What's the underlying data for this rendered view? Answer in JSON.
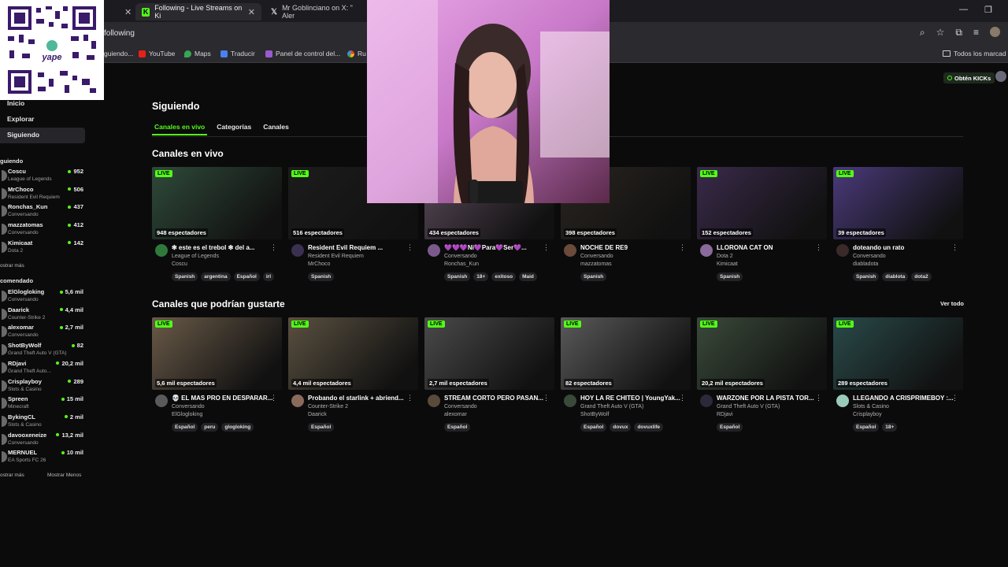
{
  "browser": {
    "tabs": [
      {
        "title": "Following - Live Streams on Ki",
        "active": true
      },
      {
        "title": "Mr Goblinciano on X: \" Aler",
        "active": false
      }
    ],
    "url": "following",
    "bookmarks": [
      "guiendo...",
      "YouTube",
      "Maps",
      "Traducir",
      "Panel de control del...",
      "Ru"
    ],
    "bookmarks_folder": "Todos los marcad"
  },
  "header": {
    "get_kicks": "Obtén KICKs"
  },
  "sidebar": {
    "nav": [
      "Inicio",
      "Explorar",
      "Siguiendo"
    ],
    "following_title": "guiendo",
    "following": [
      {
        "name": "Coscu",
        "game": "League of Legends",
        "viewers": "952"
      },
      {
        "name": "MrChoco",
        "game": "Resident Evil Requiem",
        "viewers": "506"
      },
      {
        "name": "Ronchas_Kun",
        "game": "Conversando",
        "viewers": "437"
      },
      {
        "name": "mazzatomas",
        "game": "Conversando",
        "viewers": "412"
      },
      {
        "name": "Kimicaat",
        "game": "Dota 2",
        "viewers": "142"
      }
    ],
    "show_more": "ostrar más",
    "recommended_title": "comendado",
    "recommended": [
      {
        "name": "ElGlogloking",
        "game": "Conversando",
        "viewers": "5,6 mil"
      },
      {
        "name": "Daarick",
        "game": "Counter-Strike 2",
        "viewers": "4,4 mil"
      },
      {
        "name": "alexomar",
        "game": "Conversando",
        "viewers": "2,7 mil"
      },
      {
        "name": "ShotByWolf",
        "game": "Grand Theft Auto V (GTA)",
        "viewers": "82"
      },
      {
        "name": "RDjavi",
        "game": "Grand Theft Auto...",
        "viewers": "20,2 mil"
      },
      {
        "name": "Crisplayboy",
        "game": "Slots & Casino",
        "viewers": "289"
      },
      {
        "name": "Spreen",
        "game": "Minecraft",
        "viewers": "15 mil"
      },
      {
        "name": "BykingCL",
        "game": "Slots & Casino",
        "viewers": "2 mil"
      },
      {
        "name": "davooxeneize",
        "game": "Conversando",
        "viewers": "13,2 mil"
      },
      {
        "name": "MERNUEL",
        "game": "EA Sports FC 26",
        "viewers": "10 mil"
      }
    ],
    "show_more2": "ostrar más",
    "show_less": "Mostrar Menos"
  },
  "main": {
    "title": "Siguiendo",
    "tabs": [
      "Canales en vivo",
      "Categorías",
      "Canales"
    ],
    "live_title": "Canales en vivo",
    "recommended_title": "Canales que podrían gustarte",
    "see_all": "Ver todo",
    "live_label": "LIVE",
    "live_cards": [
      {
        "title": "❇ este es el trebol ❇ del a...",
        "category": "League of Legends",
        "channel": "Coscu",
        "viewers": "948 espectadores",
        "tags": [
          "Spanish",
          "argentina",
          "Español",
          "irl"
        ],
        "color": "#2f4a3a",
        "av": "#2f7a3a"
      },
      {
        "title": "Resident Evil Requiem ...",
        "category": "Resident Evil Requiem",
        "channel": "MrChoco",
        "viewers": "516 espectadores",
        "tags": [
          "Spanish"
        ],
        "color": "#1c1c1c",
        "av": "#3a3050"
      },
      {
        "title": "💜💜💜Ni💜Para💜Ser💜...",
        "category": "Conversando",
        "channel": "Ronchas_Kun",
        "viewers": "434 espectadores",
        "tags": [
          "Spanish",
          "18+",
          "exitoso",
          "Maid"
        ],
        "color": "#5a4a5a",
        "av": "#7a5a8a"
      },
      {
        "title": "NOCHE DE RE9",
        "category": "Conversando",
        "channel": "mazzatomas",
        "viewers": "398 espectadores",
        "tags": [
          "Spanish"
        ],
        "color": "#2a2420",
        "av": "#6a4a3a"
      },
      {
        "title": "LLORONA CAT ON",
        "category": "Dota 2",
        "channel": "Kimicaat",
        "viewers": "152 espectadores",
        "tags": [
          "Spanish"
        ],
        "color": "#3a2a4a",
        "av": "#8a6a9a"
      },
      {
        "title": "doteando un rato",
        "category": "Conversando",
        "channel": "diabladota",
        "viewers": "39 espectadores",
        "tags": [
          "Spanish",
          "diablota",
          "dota2"
        ],
        "color": "#4a3a7a",
        "av": "#3a2a2a"
      }
    ],
    "rec_cards": [
      {
        "title": "💀 EL MAS PRO EN DESPARAR...",
        "category": "Conversando",
        "channel": "ElGlogloking",
        "viewers": "5,6 mil espectadores",
        "tags": [
          "Español",
          "peru",
          "glogloking"
        ],
        "color": "#6a5a48",
        "av": "#5a5a5a"
      },
      {
        "title": "Probando el starlink + abriend...",
        "category": "Counter-Strike 2",
        "channel": "Daarick",
        "viewers": "4,4 mil espectadores",
        "tags": [
          "Español"
        ],
        "color": "#5a5040",
        "av": "#8a6a5a"
      },
      {
        "title": "STREAM CORTO PERO PASAN...",
        "category": "Conversando",
        "channel": "alexomar",
        "viewers": "2,7 mil espectadores",
        "tags": [
          "Español"
        ],
        "color": "#4a4a4a",
        "av": "#5a4a3a"
      },
      {
        "title": "HOY LA RE CHITEO | YoungYak...",
        "category": "Grand Theft Auto V (GTA)",
        "channel": "ShotByWolf",
        "viewers": "82 espectadores",
        "tags": [
          "Español",
          "dovux",
          "dovuxlife"
        ],
        "color": "#5a5a5a",
        "av": "#3a4a3a"
      },
      {
        "title": "WARZONE POR LA PISTA TOR...",
        "category": "Grand Theft Auto V (GTA)",
        "channel": "RDjavi",
        "viewers": "20,2 mil espectadores",
        "tags": [
          "Español"
        ],
        "color": "#3a4a3a",
        "av": "#2a2a3a"
      },
      {
        "title": "LLEGANDO A CRISPRIMEBOY :...",
        "category": "Slots & Casino",
        "channel": "Crisplayboy",
        "viewers": "289 espectadores",
        "tags": [
          "Español",
          "18+"
        ],
        "color": "#2a4a4a",
        "av": "#9acaba"
      }
    ]
  }
}
